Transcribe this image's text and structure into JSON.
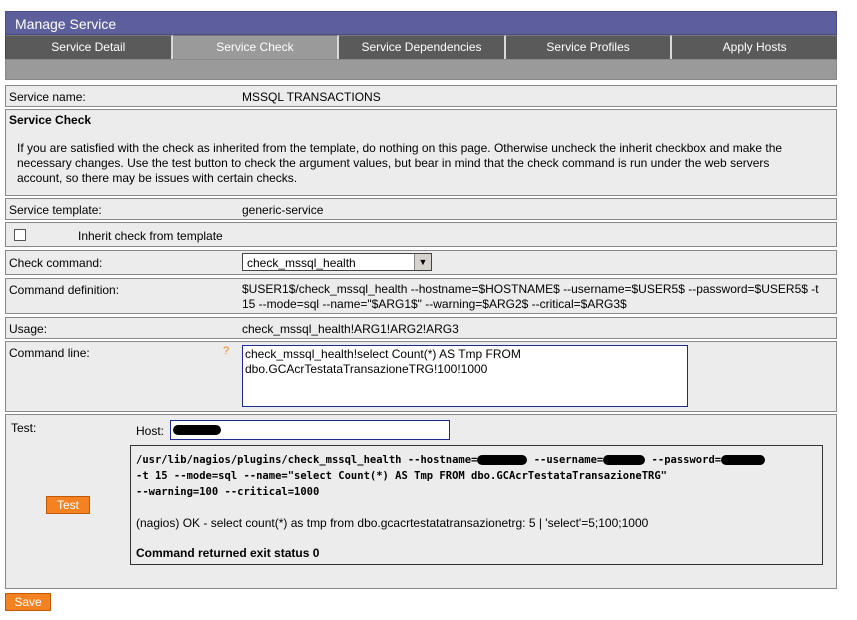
{
  "header": {
    "title": "Manage Service"
  },
  "tabs": [
    {
      "label": "Service Detail",
      "active": false
    },
    {
      "label": "Service Check",
      "active": true
    },
    {
      "label": "Service Dependencies",
      "active": false
    },
    {
      "label": "Service Profiles",
      "active": false
    },
    {
      "label": "Apply Hosts",
      "active": false
    }
  ],
  "service_name": {
    "label": "Service name:",
    "value": "MSSQL TRANSACTIONS"
  },
  "service_check": {
    "heading": "Service Check",
    "description": "If you are satisfied with the check as inherited from the template, do nothing on this page. Otherwise uncheck the inherit checkbox and make the necessary changes. Use the test button to check the argument values, but bear in mind that the check command is run under the web servers account, so there may be issues with certain checks."
  },
  "service_template": {
    "label": "Service template:",
    "value": "generic-service"
  },
  "inherit": {
    "label": "Inherit check from template",
    "checked": false
  },
  "check_command": {
    "label": "Check command:",
    "selected": "check_mssql_health"
  },
  "command_definition": {
    "label": "Command definition:",
    "value": "$USER1$/check_mssql_health --hostname=$HOSTNAME$ --username=$USER5$ --password=$USER5$ -t 15 --mode=sql --name=\"$ARG1$\" --warning=$ARG2$ --critical=$ARG3$"
  },
  "usage": {
    "label": "Usage:",
    "value": "check_mssql_health!ARG1!ARG2!ARG3"
  },
  "command_line": {
    "label": "Command line:",
    "help": "?",
    "value": "check_mssql_health!select Count(*) AS Tmp FROM dbo.GCAcrTestataTransazioneTRG!100!1000"
  },
  "test": {
    "label": "Test:",
    "host_label": "Host:",
    "button": "Test",
    "output": {
      "cmd1_a": "/usr/lib/nagios/plugins/check_mssql_health --hostname=",
      "cmd1_b": " --username=",
      "cmd1_c": " --password=",
      "cmd2": "-t 15 --mode=sql --name=\"select Count(*) AS Tmp FROM dbo.GCAcrTestataTransazioneTRG\"",
      "cmd3": "--warning=100 --critical=1000",
      "result": "(nagios) OK - select count(*) as tmp from dbo.gcacrtestatatransazionetrg: 5 | 'select'=5;100;1000",
      "exit": "Command returned exit status 0"
    }
  },
  "footer": {
    "save_label": "Save"
  },
  "colors": {
    "title_bar": "#5d5f9d",
    "tab_bg": "#5a5a5a",
    "active_tab": "#9a9a9a",
    "row_bg": "#ececec",
    "button": "#f58220",
    "help": "#f58220"
  }
}
